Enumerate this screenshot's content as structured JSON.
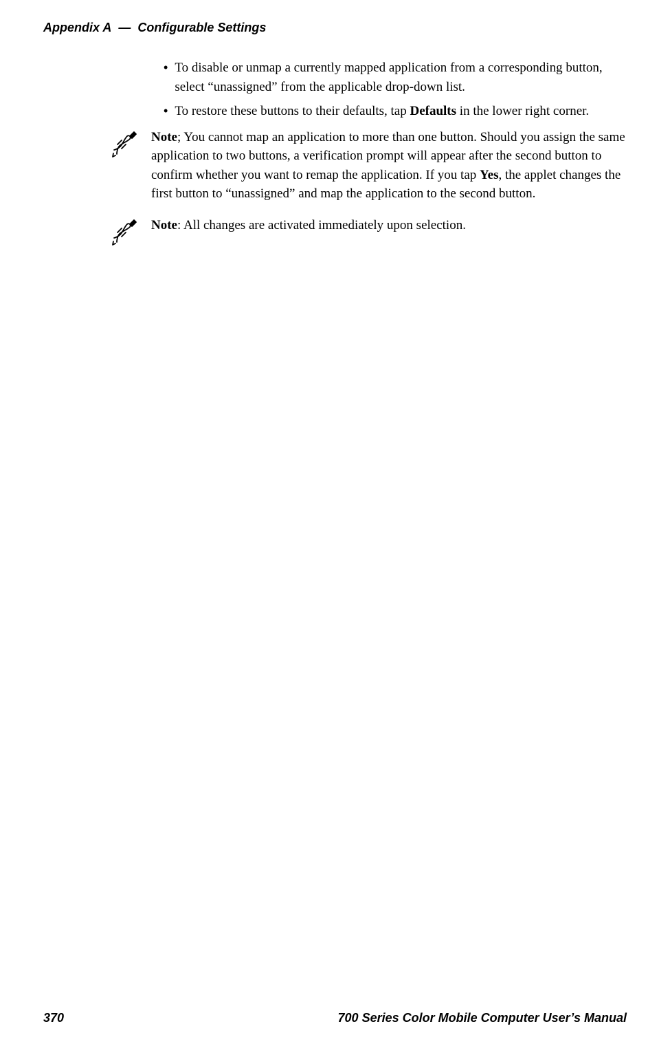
{
  "header": {
    "appendix": "Appendix  A",
    "dash": "—",
    "title": "Configurable Settings"
  },
  "bullets": [
    {
      "before": "To disable or unmap a currently mapped application from a corresponding button, select “unassigned” from the applicable drop-down list.",
      "bold": "",
      "after": ""
    },
    {
      "before": "To restore these buttons to their defaults, tap ",
      "bold": "Defaults",
      "after": " in the lower right corner."
    }
  ],
  "notes": [
    {
      "label": "Note",
      "sep": "; ",
      "before": "You cannot map an application to more than one button. Should you assign the same application to two buttons, a verification prompt will appear after the second button to confirm whether you want to remap the application. If you tap ",
      "bold": "Yes",
      "after": ", the applet changes the first button to “unassigned” and map the application to the second button."
    },
    {
      "label": "Note",
      "sep": ": ",
      "before": "All changes are activated immediately upon selection.",
      "bold": "",
      "after": ""
    }
  ],
  "footer": {
    "page": "370",
    "manual": "700 Series Color Mobile Computer User’s Manual"
  }
}
